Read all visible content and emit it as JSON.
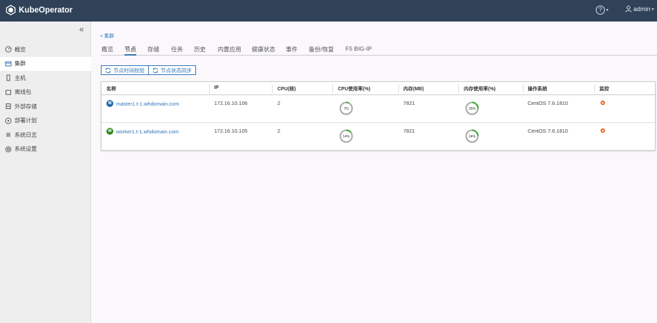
{
  "app": {
    "name": "KubeOperator"
  },
  "header": {
    "help_icon": "question-circle-icon",
    "user_label": "admin"
  },
  "sidebar": {
    "collapse_label": "«",
    "items": [
      {
        "label": "概览",
        "icon": "dashboard-icon"
      },
      {
        "label": "集群",
        "icon": "cluster-icon",
        "active": true
      },
      {
        "label": "主机",
        "icon": "host-icon"
      },
      {
        "label": "离线包",
        "icon": "package-icon"
      },
      {
        "label": "外部存储",
        "icon": "storage-icon"
      },
      {
        "label": "部署计划",
        "icon": "plan-icon"
      },
      {
        "label": "系统日志",
        "icon": "log-icon"
      },
      {
        "label": "系统设置",
        "icon": "settings-icon"
      }
    ]
  },
  "main": {
    "back_link": "< 集群",
    "tabs": [
      "概览",
      "节点",
      "存储",
      "任务",
      "历史",
      "内置应用",
      "健康状态",
      "事件",
      "备份/恢复",
      "F5 BIG-IP"
    ],
    "active_tab": "节点",
    "buttons": {
      "time_sync": "节点时间校验",
      "status_sync": "节点状态同步"
    },
    "table": {
      "columns": [
        "名称",
        "IP",
        "CPU(核)",
        "CPU使用率(%)",
        "内存(MB)",
        "内存使用率(%)",
        "操作系统",
        "监控"
      ],
      "rows": [
        {
          "badge": "M",
          "badge_color": "#1f6bb3",
          "name": "master1.t-1.whdomain.com",
          "ip": "172.16.10.106",
          "cpu": "2",
          "cpu_usage": 7,
          "cpu_usage_label": "7%",
          "memory": "7821",
          "mem_usage": 26,
          "mem_usage_label": "26%",
          "os": "CentOS 7.6.1810"
        },
        {
          "badge": "W",
          "badge_color": "#2f8a1e",
          "name": "worker1.t-1.whdomain.com",
          "ip": "172.16.10.105",
          "cpu": "2",
          "cpu_usage": 14,
          "cpu_usage_label": "14%",
          "memory": "7821",
          "mem_usage": 24,
          "mem_usage_label": "24%",
          "os": "CentOS 7.6.1810"
        }
      ]
    }
  },
  "colors": {
    "topbar": "#2f4258",
    "accent": "#2f74b5",
    "ring_fill": "#3aa62c",
    "ring_track": "#a7a7a7",
    "monitor": "#e8661c"
  }
}
